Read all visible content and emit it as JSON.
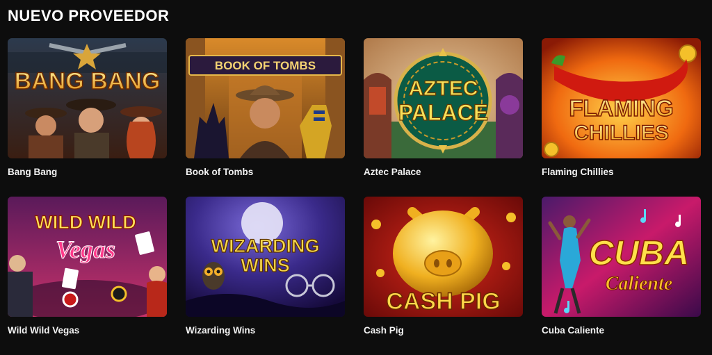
{
  "section": {
    "title": "NUEVO PROVEEDOR"
  },
  "games": [
    {
      "name": "Bang Bang",
      "logo": [
        "BANG BANG"
      ],
      "icon": "bang-bang-artwork"
    },
    {
      "name": "Book of Tombs",
      "logo": [
        "BOOK OF TOMBS"
      ],
      "icon": "book-of-tombs-artwork"
    },
    {
      "name": "Aztec Palace",
      "logo": [
        "AZTEC",
        "PALACE"
      ],
      "icon": "aztec-palace-artwork"
    },
    {
      "name": "Flaming Chillies",
      "logo": [
        "FLAMING",
        "CHILLIES"
      ],
      "icon": "flaming-chillies-artwork"
    },
    {
      "name": "Wild Wild Vegas",
      "logo": [
        "WILD WILD",
        "Vegas"
      ],
      "icon": "wild-wild-vegas-artwork"
    },
    {
      "name": "Wizarding Wins",
      "logo": [
        "WIZARDING",
        "WINS"
      ],
      "icon": "wizarding-wins-artwork"
    },
    {
      "name": "Cash Pig",
      "logo": [
        "CASH PIG"
      ],
      "icon": "cash-pig-artwork"
    },
    {
      "name": "Cuba Caliente",
      "logo": [
        "CUBA",
        "Caliente"
      ],
      "icon": "cuba-caliente-artwork"
    }
  ],
  "colors": {
    "background": "#0d0d0d",
    "text": "#ffffff"
  }
}
